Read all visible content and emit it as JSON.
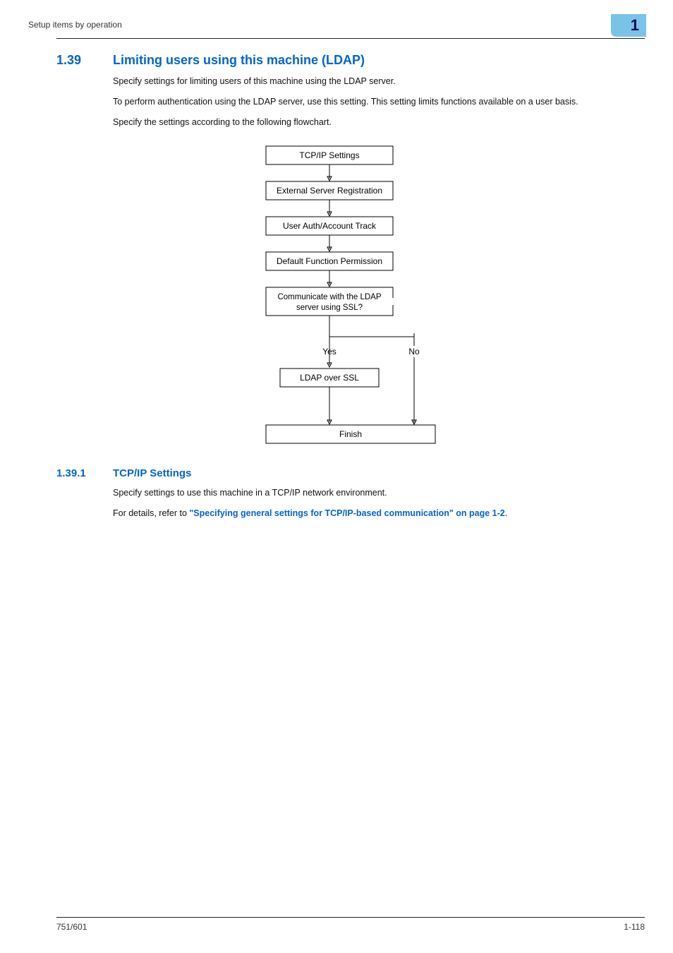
{
  "header": {
    "left_text": "Setup items by operation",
    "page_indicator": "1"
  },
  "section": {
    "num": "1.39",
    "title": "Limiting users using this machine (LDAP)",
    "p1": "Specify settings for limiting users of this machine using the LDAP server.",
    "p2": "To perform authentication using the LDAP server, use this setting. This setting limits functions available on a user basis.",
    "p3": "Specify the settings according to the following flowchart."
  },
  "flowchart": {
    "box1": "TCP/IP Settings",
    "box2": "External Server Registration",
    "box3": "User Auth/Account Track",
    "box4": "Default Function Permission",
    "box5_l1": "Communicate with the LDAP",
    "box5_l2": "server using SSL?",
    "yes": "Yes",
    "no": "No",
    "box6": "LDAP over SSL",
    "finish": "Finish"
  },
  "subsection": {
    "num": "1.39.1",
    "title": "TCP/IP Settings",
    "p1": "Specify settings to use this machine in a TCP/IP network environment.",
    "p2_prefix": "For details, refer to ",
    "p2_link": "\"Specifying general settings for TCP/IP-based communication\" on page 1-2",
    "p2_suffix": "."
  },
  "footer": {
    "left": "751/601",
    "right": "1-118"
  }
}
